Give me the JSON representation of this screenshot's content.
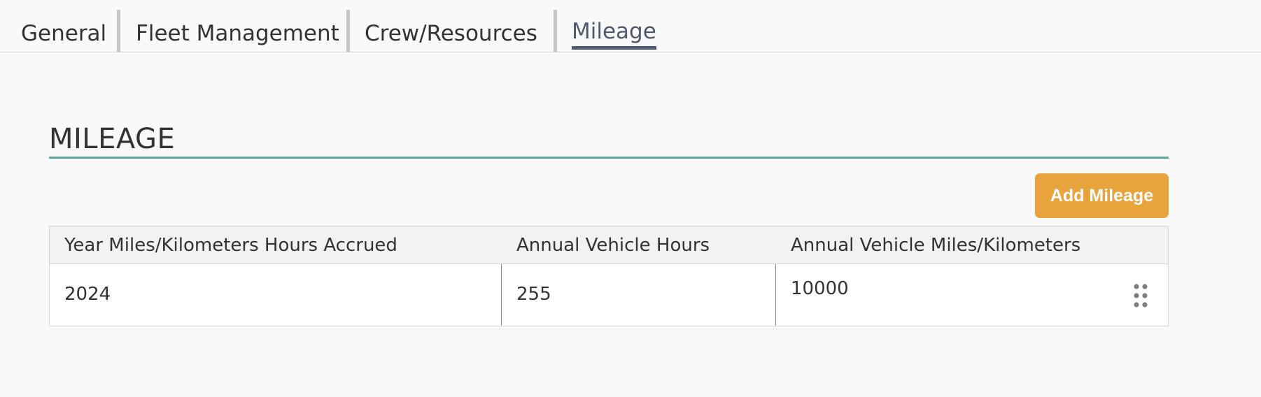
{
  "tabs": [
    {
      "label": "General"
    },
    {
      "label": "Fleet Management"
    },
    {
      "label": "Crew/Resources"
    },
    {
      "label": "Mileage",
      "active": true
    }
  ],
  "section": {
    "title": "MILEAGE",
    "rule_color": "#5ba597"
  },
  "actions": {
    "add_label": "Add Mileage",
    "add_color": "#e8a33d"
  },
  "table": {
    "columns": [
      "Year Miles/Kilometers Hours Accrued",
      "Annual Vehicle Hours",
      "Annual Vehicle Miles/Kilometers"
    ],
    "rows": [
      {
        "year": "2024",
        "hours": "255",
        "miles": "10000",
        "row_menu_icon": "drag-dots-icon"
      }
    ]
  }
}
